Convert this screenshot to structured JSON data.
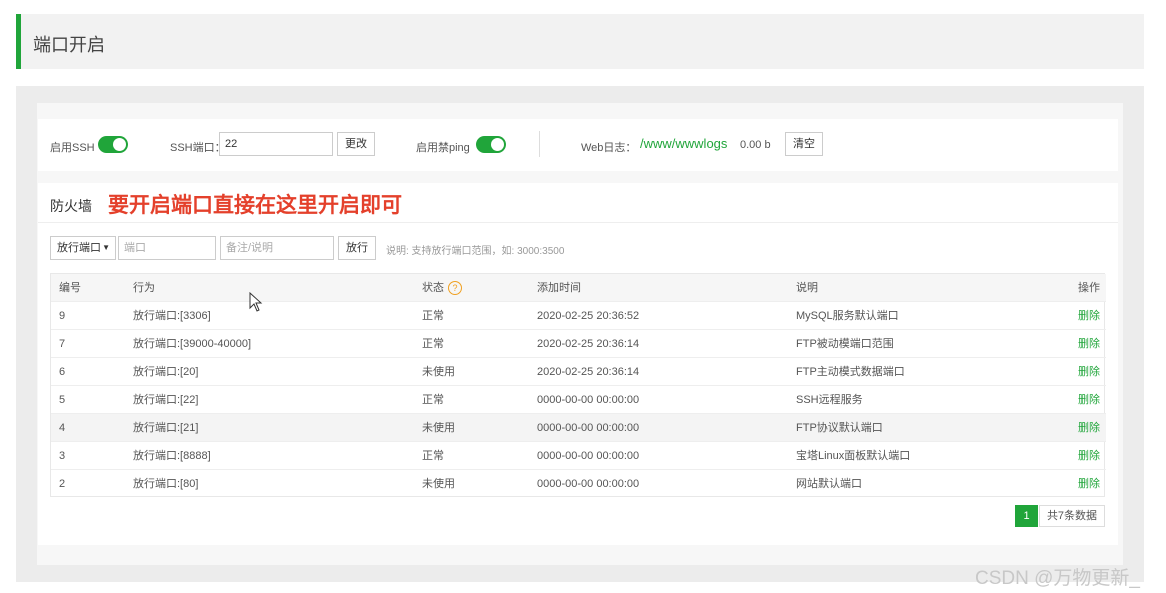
{
  "page": {
    "title": "端口开启"
  },
  "settings": {
    "ssh_label": "启用SSH",
    "ssh_enabled": true,
    "ssh_port_label": "SSH端口：",
    "ssh_port_value": "22",
    "change_button": "更改",
    "ping_label": "启用禁ping",
    "ping_enabled": true,
    "web_log_label": "Web日志：",
    "web_log_path": "/www/wwwlogs",
    "web_log_size": "0.00 b",
    "clear_button": "清空"
  },
  "firewall": {
    "title": "防火墙",
    "hint": "要开启端口直接在这里开启即可",
    "type_select": "放行端口",
    "port_placeholder": "端口",
    "note_placeholder": "备注/说明",
    "allow_button": "放行",
    "help_text": "说明: 支持放行端口范围，如: 3000:3500"
  },
  "table": {
    "headers": {
      "id": "编号",
      "action": "行为",
      "status": "状态",
      "time": "添加时间",
      "desc": "说明",
      "op": "操作"
    },
    "status_help_icon": "?",
    "rows": [
      {
        "id": "9",
        "action": "放行端口:[3306]",
        "status": "正常",
        "time": "2020-02-25 20:36:52",
        "desc": "MySQL服务默认端口",
        "op": "删除"
      },
      {
        "id": "7",
        "action": "放行端口:[39000-40000]",
        "status": "正常",
        "time": "2020-02-25 20:36:14",
        "desc": "FTP被动模端口范围",
        "op": "删除"
      },
      {
        "id": "6",
        "action": "放行端口:[20]",
        "status": "未使用",
        "time": "2020-02-25 20:36:14",
        "desc": "FTP主动模式数据端口",
        "op": "删除"
      },
      {
        "id": "5",
        "action": "放行端口:[22]",
        "status": "正常",
        "time": "0000-00-00 00:00:00",
        "desc": "SSH远程服务",
        "op": "删除"
      },
      {
        "id": "4",
        "action": "放行端口:[21]",
        "status": "未使用",
        "time": "0000-00-00 00:00:00",
        "desc": "FTP协议默认端口",
        "op": "删除"
      },
      {
        "id": "3",
        "action": "放行端口:[8888]",
        "status": "正常",
        "time": "0000-00-00 00:00:00",
        "desc": "宝塔Linux面板默认端口",
        "op": "删除"
      },
      {
        "id": "2",
        "action": "放行端口:[80]",
        "status": "未使用",
        "time": "0000-00-00 00:00:00",
        "desc": "网站默认端口",
        "op": "删除"
      }
    ]
  },
  "pagination": {
    "current": "1",
    "total": "共7条数据"
  },
  "watermark": "CSDN @万物更新_",
  "colors": {
    "accent": "#20a53a",
    "hint": "#e4402b"
  }
}
